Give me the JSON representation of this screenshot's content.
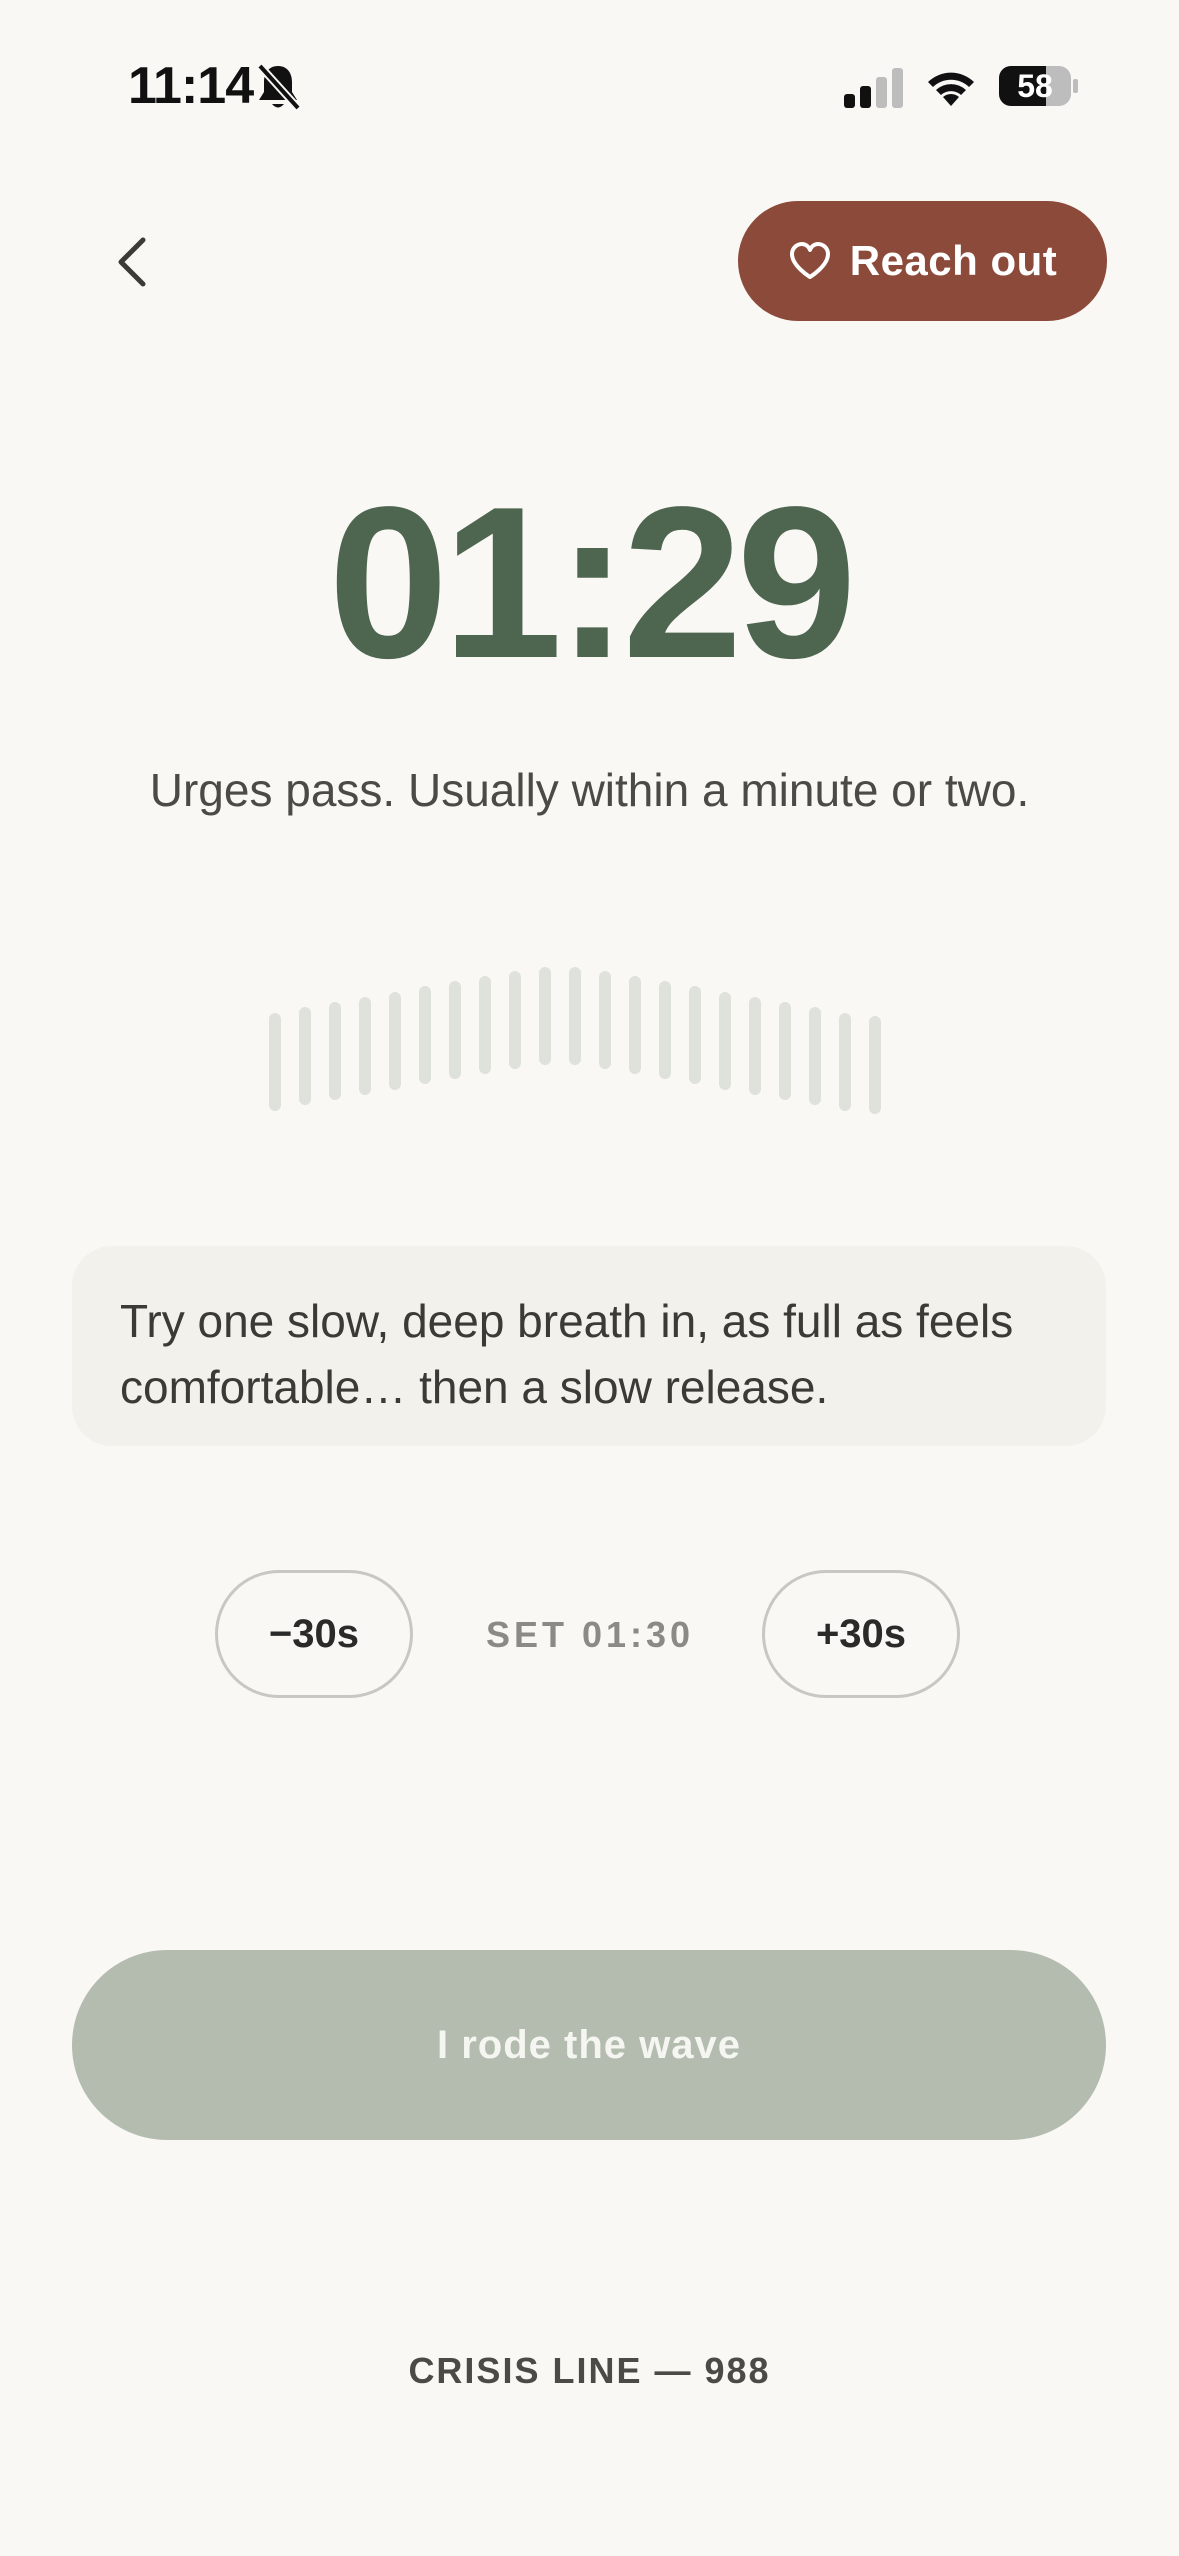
{
  "status_bar": {
    "time": "11:14",
    "battery": "58",
    "icons": [
      "bell-slash-icon",
      "cellular-signal-icon",
      "wifi-icon",
      "battery-icon"
    ]
  },
  "header": {
    "back_icon": "chevron-left-icon",
    "reach_out_label": "Reach out",
    "reach_out_icon": "heart-outline-icon"
  },
  "timer": {
    "display": "01:29",
    "message": "Urges pass. Usually within a minute or two."
  },
  "prompt": {
    "text": "Try one slow, deep breath in, as full as feels comfortable… then a slow release."
  },
  "adjust": {
    "minus_label": "−30s",
    "set_label": "SET 01:30",
    "plus_label": "+30s"
  },
  "primary_action": {
    "label": "I rode the wave"
  },
  "footer": {
    "crisis_line": "CRISIS LINE — 988"
  },
  "colors": {
    "background": "#FAF8F5",
    "accent_green": "#4E6650",
    "reach_out": "#8C4A3A",
    "primary_disabled": "#B3BCAF",
    "wave_bar": "#DFE2DB"
  }
}
